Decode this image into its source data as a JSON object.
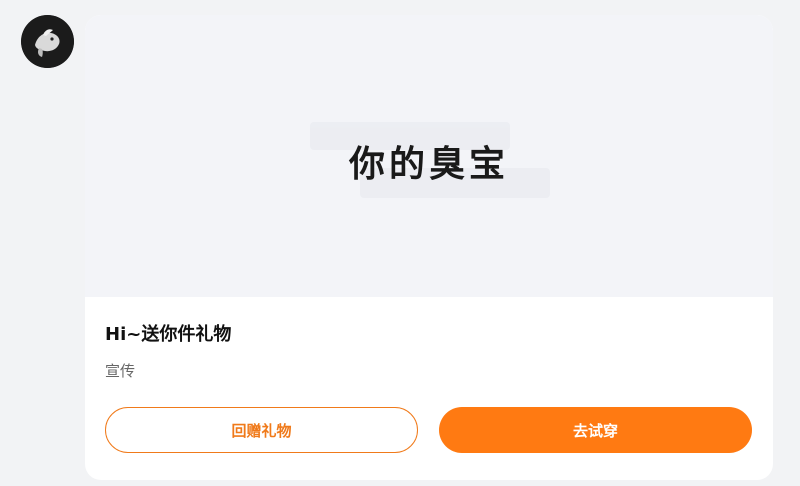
{
  "message": {
    "avatar_icon": "user-avatar-dog-photo",
    "sticker_text": "你的臭宝",
    "title": "Hi~送你件礼物",
    "subtitle": "宣传",
    "buttons": {
      "gift_back_label": "回赠礼物",
      "try_on_label": "去试穿"
    }
  },
  "colors": {
    "accent": "#ff7a12",
    "background": "#f2f3f5",
    "media_bg": "#f3f4f8"
  }
}
